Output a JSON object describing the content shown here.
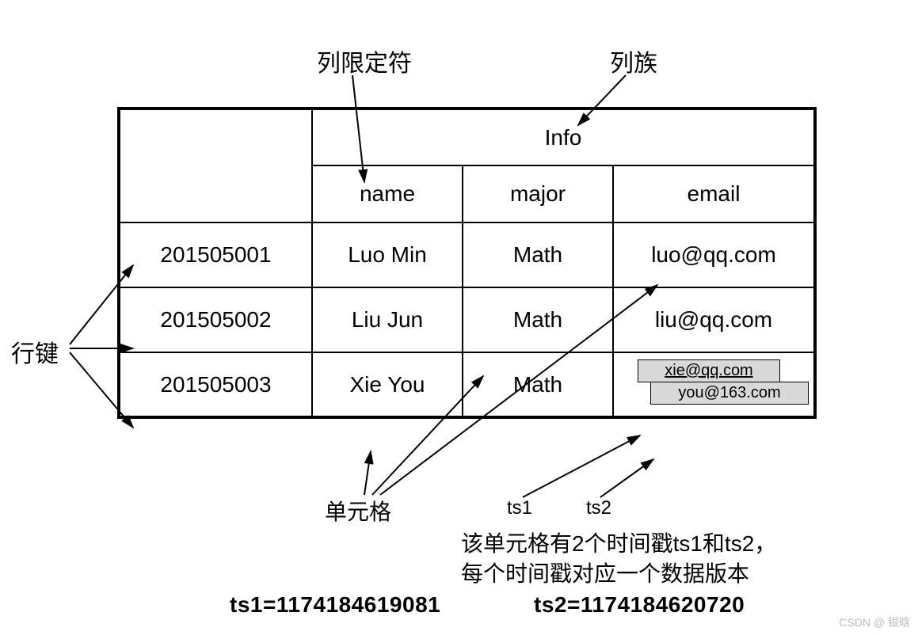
{
  "labels": {
    "column_qualifier": "列限定符",
    "column_family": "列族",
    "row_key": "行键",
    "cell": "单元格",
    "ts1": "ts1",
    "ts2": "ts2",
    "desc1": "该单元格有2个时间戳ts1和ts2，",
    "desc2": "每个时间戳对应一个数据版本",
    "ts1_value": "ts1=1174184619081",
    "ts2_value": "ts2=1174184620720",
    "watermark": "CSDN @ 银晗"
  },
  "table": {
    "column_family_header": "Info",
    "columns": [
      "name",
      "major",
      "email"
    ],
    "rows": [
      {
        "rowkey": "201505001",
        "name": "Luo Min",
        "major": "Math",
        "email": "luo@qq.com"
      },
      {
        "rowkey": "201505002",
        "name": "Liu Jun",
        "major": "Math",
        "email": "liu@qq.com"
      },
      {
        "rowkey": "201505003",
        "name": "Xie You",
        "major": "Math",
        "email_versions": [
          "xie@qq.com",
          "you@163.com"
        ]
      }
    ]
  }
}
